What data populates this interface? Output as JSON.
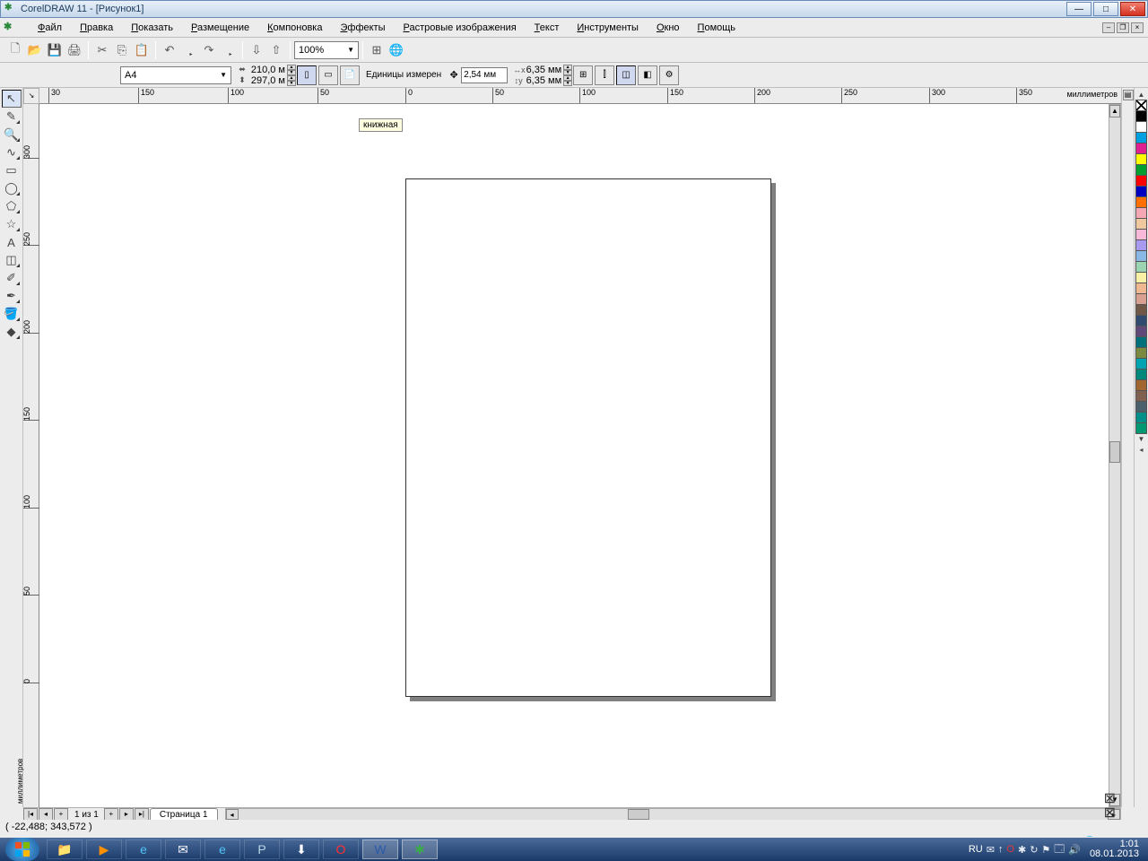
{
  "title": "CorelDRAW 11 - [Рисунок1]",
  "menus": [
    "Файл",
    "Правка",
    "Показать",
    "Размещение",
    "Компоновка",
    "Эффекты",
    "Растровые изображения",
    "Текст",
    "Инструменты",
    "Окно",
    "Помощь"
  ],
  "zoom": "100%",
  "propbar": {
    "paper": "A4",
    "width": "210,0 м",
    "height": "297,0 м",
    "units_label": "Единицы измерен",
    "nudge": "2,54 мм",
    "dup_x": "6,35 мм",
    "dup_y": "6,35 мм"
  },
  "tooltip": "книжная",
  "ruler_unit": "миллиметров",
  "ruler_h_ticks": [
    {
      "pos": 10,
      "label": "30"
    },
    {
      "pos": 110,
      "label": "150"
    },
    {
      "pos": 210,
      "label": "100"
    },
    {
      "pos": 310,
      "label": "50"
    },
    {
      "pos": 408,
      "label": "0"
    },
    {
      "pos": 505,
      "label": "50"
    },
    {
      "pos": 602,
      "label": "100"
    },
    {
      "pos": 700,
      "label": "150"
    },
    {
      "pos": 797,
      "label": "200"
    },
    {
      "pos": 894,
      "label": "250"
    },
    {
      "pos": 992,
      "label": "300"
    },
    {
      "pos": 1089,
      "label": "350"
    }
  ],
  "ruler_v_ticks": [
    {
      "pos": 60,
      "label": "300"
    },
    {
      "pos": 157,
      "label": "250"
    },
    {
      "pos": 255,
      "label": "200"
    },
    {
      "pos": 352,
      "label": "150"
    },
    {
      "pos": 450,
      "label": "100"
    },
    {
      "pos": 547,
      "label": "50"
    },
    {
      "pos": 645,
      "label": "0"
    }
  ],
  "page_nav": {
    "counter": "1 из 1",
    "tab": "Страница 1"
  },
  "coords": "( -22,488; 343,572 )",
  "palette": [
    "#000000",
    "#ffffff",
    "#00a0e0",
    "#e02090",
    "#ffff00",
    "#00a030",
    "#ff0000",
    "#0000c0",
    "#ff7000",
    "#f4a8b4",
    "#f0c8a0",
    "#f8b8d8",
    "#a89af0",
    "#8ab8e4",
    "#9ad4b0",
    "#f8f0a4",
    "#f0b890",
    "#d8a090",
    "#705848",
    "#304a70",
    "#604878",
    "#00707a",
    "#7a8a40",
    "#00a4b0",
    "#00887a",
    "#a06830",
    "#806050",
    "#4a606a",
    "#00908a",
    "#009870"
  ],
  "taskbar": {
    "lang": "RU",
    "time": "1:01",
    "date": "08.01.2013"
  }
}
